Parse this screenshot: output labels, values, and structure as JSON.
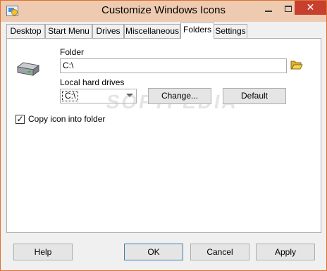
{
  "window": {
    "title": "Customize Windows Icons",
    "close_glyph": "✕",
    "accent_border": "#e07030",
    "titlebar_color": "#eecbb0",
    "close_color": "#c7402e"
  },
  "tabs": [
    {
      "label": "Desktop"
    },
    {
      "label": "Start Menu"
    },
    {
      "label": "Drives"
    },
    {
      "label": "Miscellaneous"
    },
    {
      "label": "Folders",
      "active": true
    },
    {
      "label": "Settings"
    }
  ],
  "folders": {
    "icon": "hard-drive-icon",
    "folder_label": "Folder",
    "folder_value": "C:\\",
    "browse_icon": "open-folder-icon",
    "drives_label": "Local hard drives",
    "drives_selected": "C:\\",
    "change_label": "Change...",
    "default_label": "Default",
    "copy_checkbox_label": "Copy icon into folder",
    "copy_checked": true,
    "check_glyph": "✓"
  },
  "watermark": "SOFTPEDIA",
  "footer": {
    "help_label": "Help",
    "ok_label": "OK",
    "cancel_label": "Cancel",
    "apply_label": "Apply"
  }
}
